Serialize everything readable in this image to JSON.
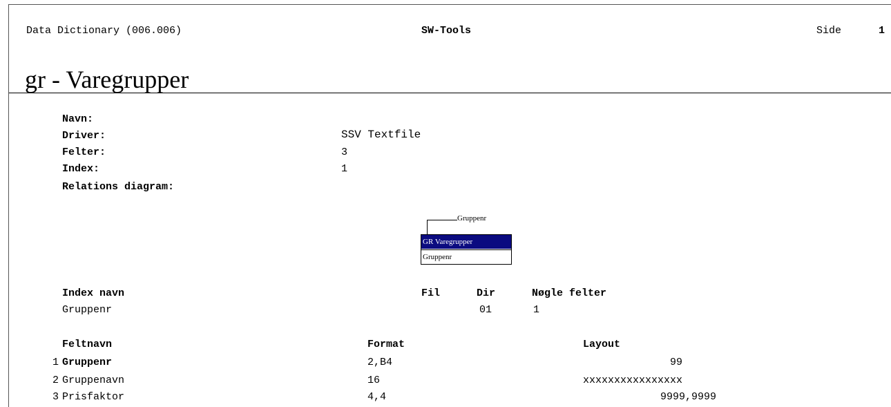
{
  "header": {
    "left": "Data Dictionary (006.006)",
    "center": "SW-Tools",
    "page_label": "Side",
    "page_number": "1"
  },
  "title": "gr - Varegrupper",
  "info": {
    "navn_label": "Navn:",
    "driver_label": "Driver:",
    "driver_value": "SSV Textfile",
    "felter_label": "Felter:",
    "felter_value": "3",
    "index_label": "Index:",
    "index_value": "1",
    "relations_label": "Relations diagram:"
  },
  "diagram": {
    "relation_label": "Gruppenr",
    "entity_title": "GR Varegrupper",
    "entity_field": "Gruppenr"
  },
  "index_table": {
    "headers": {
      "name": "Index navn",
      "fil": "Fil",
      "dir": "Dir",
      "keys": "Nøgle felter"
    },
    "rows": [
      {
        "name": "Gruppenr",
        "fil": "",
        "dir": "01",
        "keys": "1"
      }
    ]
  },
  "field_table": {
    "headers": {
      "name": "Feltnavn",
      "format": "Format",
      "layout": "Layout"
    },
    "rows": [
      {
        "num": "1",
        "name": "Gruppenr",
        "format": "2,B4",
        "layout": "99"
      },
      {
        "num": "2",
        "name": "Gruppenavn",
        "format": "16",
        "layout": "xxxxxxxxxxxxxxxx"
      },
      {
        "num": "3",
        "name": "Prisfaktor",
        "format": "4,4",
        "layout": "9999,9999"
      }
    ]
  }
}
